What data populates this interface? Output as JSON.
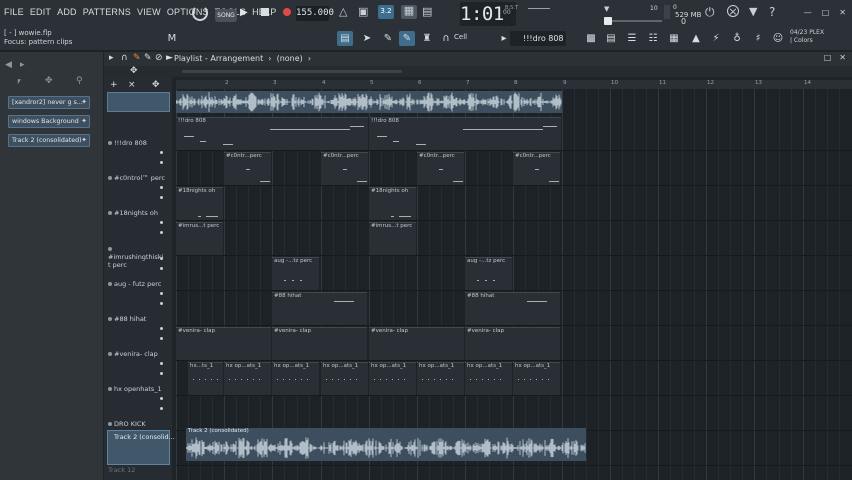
{
  "menu": [
    "FILE",
    "EDIT",
    "ADD",
    "PATTERNS",
    "VIEW",
    "OPTIONS",
    "TOOLS",
    "HELP"
  ],
  "transport": {
    "mode_label": "SONG",
    "tempo": "155.000",
    "time": "1:01",
    "time_small": "00",
    "time_sig_label": "B:S:T",
    "pitch_value": "10"
  },
  "status": {
    "cpu": "0",
    "memory": "529 MB",
    "zeros": "0",
    "hint_file": "[ - ] wowie.flp",
    "hint_focus": "Focus: pattern clips"
  },
  "toolbar": {
    "snap_label": "Cell",
    "pattern_name": "!!!dro 808",
    "plex_line1": "04/23  PLEX",
    "plex_line2": "| Colors"
  },
  "browser": {
    "items": [
      {
        "label": "[xandror2] never g s..."
      },
      {
        "label": "windows Background"
      },
      {
        "label": "Track 2 (consolidated)"
      }
    ]
  },
  "playlist": {
    "title": "Playlist - Arrangement",
    "pattern_ref": "(none)",
    "bar_numbers": [
      "2",
      "3",
      "4",
      "5",
      "6",
      "7",
      "8",
      "9",
      "10",
      "11",
      "12",
      "13",
      "14"
    ],
    "tracks": [
      {
        "name": "!!!dro 808"
      },
      {
        "name": "#c0ntrol™ perc"
      },
      {
        "name": "#18nights oh"
      },
      {
        "name": "#imrushingthiski t perc"
      },
      {
        "name": "aug - futz perc"
      },
      {
        "name": "#88 hihat"
      },
      {
        "name": "#venira- clap"
      },
      {
        "name": "hx openhats_1"
      },
      {
        "name": "DRO KICK"
      },
      {
        "name": "Track 2 (consolid..."
      },
      {
        "name": "Track 12"
      }
    ],
    "clips": {
      "dro808": [
        "!!!dro 808",
        "!!!dro 808"
      ],
      "control": [
        "#c0ntr...perc",
        "#c0ntr...perc",
        "#c0ntr...perc",
        "#c0ntr...perc"
      ],
      "nights": [
        "#18nights oh",
        "#18nights oh"
      ],
      "rush": [
        "#imrus...t perc",
        "#imrus...t perc"
      ],
      "futz": [
        "aug -...tz perc",
        "aug -...tz perc"
      ],
      "hihat": [
        "#88 hihat",
        "#88 hihat"
      ],
      "venira": [
        "#venira- clap",
        "#venira- clap",
        "#venira- clap",
        "#venira- clap"
      ],
      "openhats": [
        "hx...ts_1",
        "hx op...ats_1",
        "hx op...ats_1",
        "hx op...ats_1",
        "hx op...ats_1",
        "hx op...ats_1",
        "hx op...ats_1",
        "hx op...ats_1"
      ],
      "track2_audio": "Track 2 (consolidated)"
    }
  }
}
